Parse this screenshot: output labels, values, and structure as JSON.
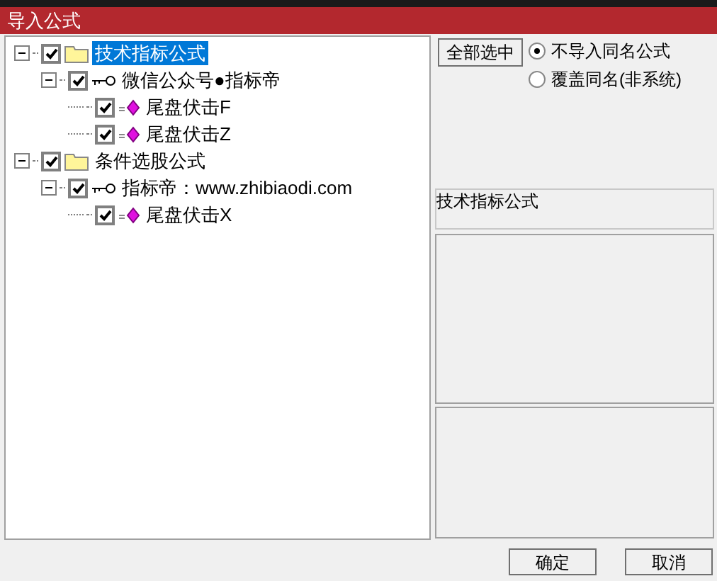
{
  "window": {
    "title": "导入公式"
  },
  "tree": [
    {
      "kind": "folder",
      "label": "技术指标公式",
      "selected": true,
      "checked": true,
      "expanded": true,
      "children": [
        {
          "kind": "group",
          "label": "微信公众号●指标帝",
          "selected": false,
          "checked": true,
          "expanded": true,
          "children": [
            {
              "kind": "formula",
              "label": "尾盘伏击F",
              "selected": false,
              "checked": true
            },
            {
              "kind": "formula",
              "label": "尾盘伏击Z",
              "selected": false,
              "checked": true
            }
          ]
        }
      ]
    },
    {
      "kind": "folder",
      "label": "条件选股公式",
      "selected": false,
      "checked": true,
      "expanded": true,
      "children": [
        {
          "kind": "group",
          "label": "指标帝：www.zhibiaodi.com",
          "selected": false,
          "checked": true,
          "expanded": true,
          "children": [
            {
              "kind": "formula",
              "label": "尾盘伏击X",
              "selected": false,
              "checked": true
            }
          ]
        }
      ]
    }
  ],
  "select_all_button": "全部选中",
  "options": [
    {
      "label": "不导入同名公式",
      "selected": true
    },
    {
      "label": "覆盖同名(非系统)",
      "selected": false
    }
  ],
  "info_field": "技术指标公式",
  "buttons": [
    "确定",
    "取消"
  ]
}
